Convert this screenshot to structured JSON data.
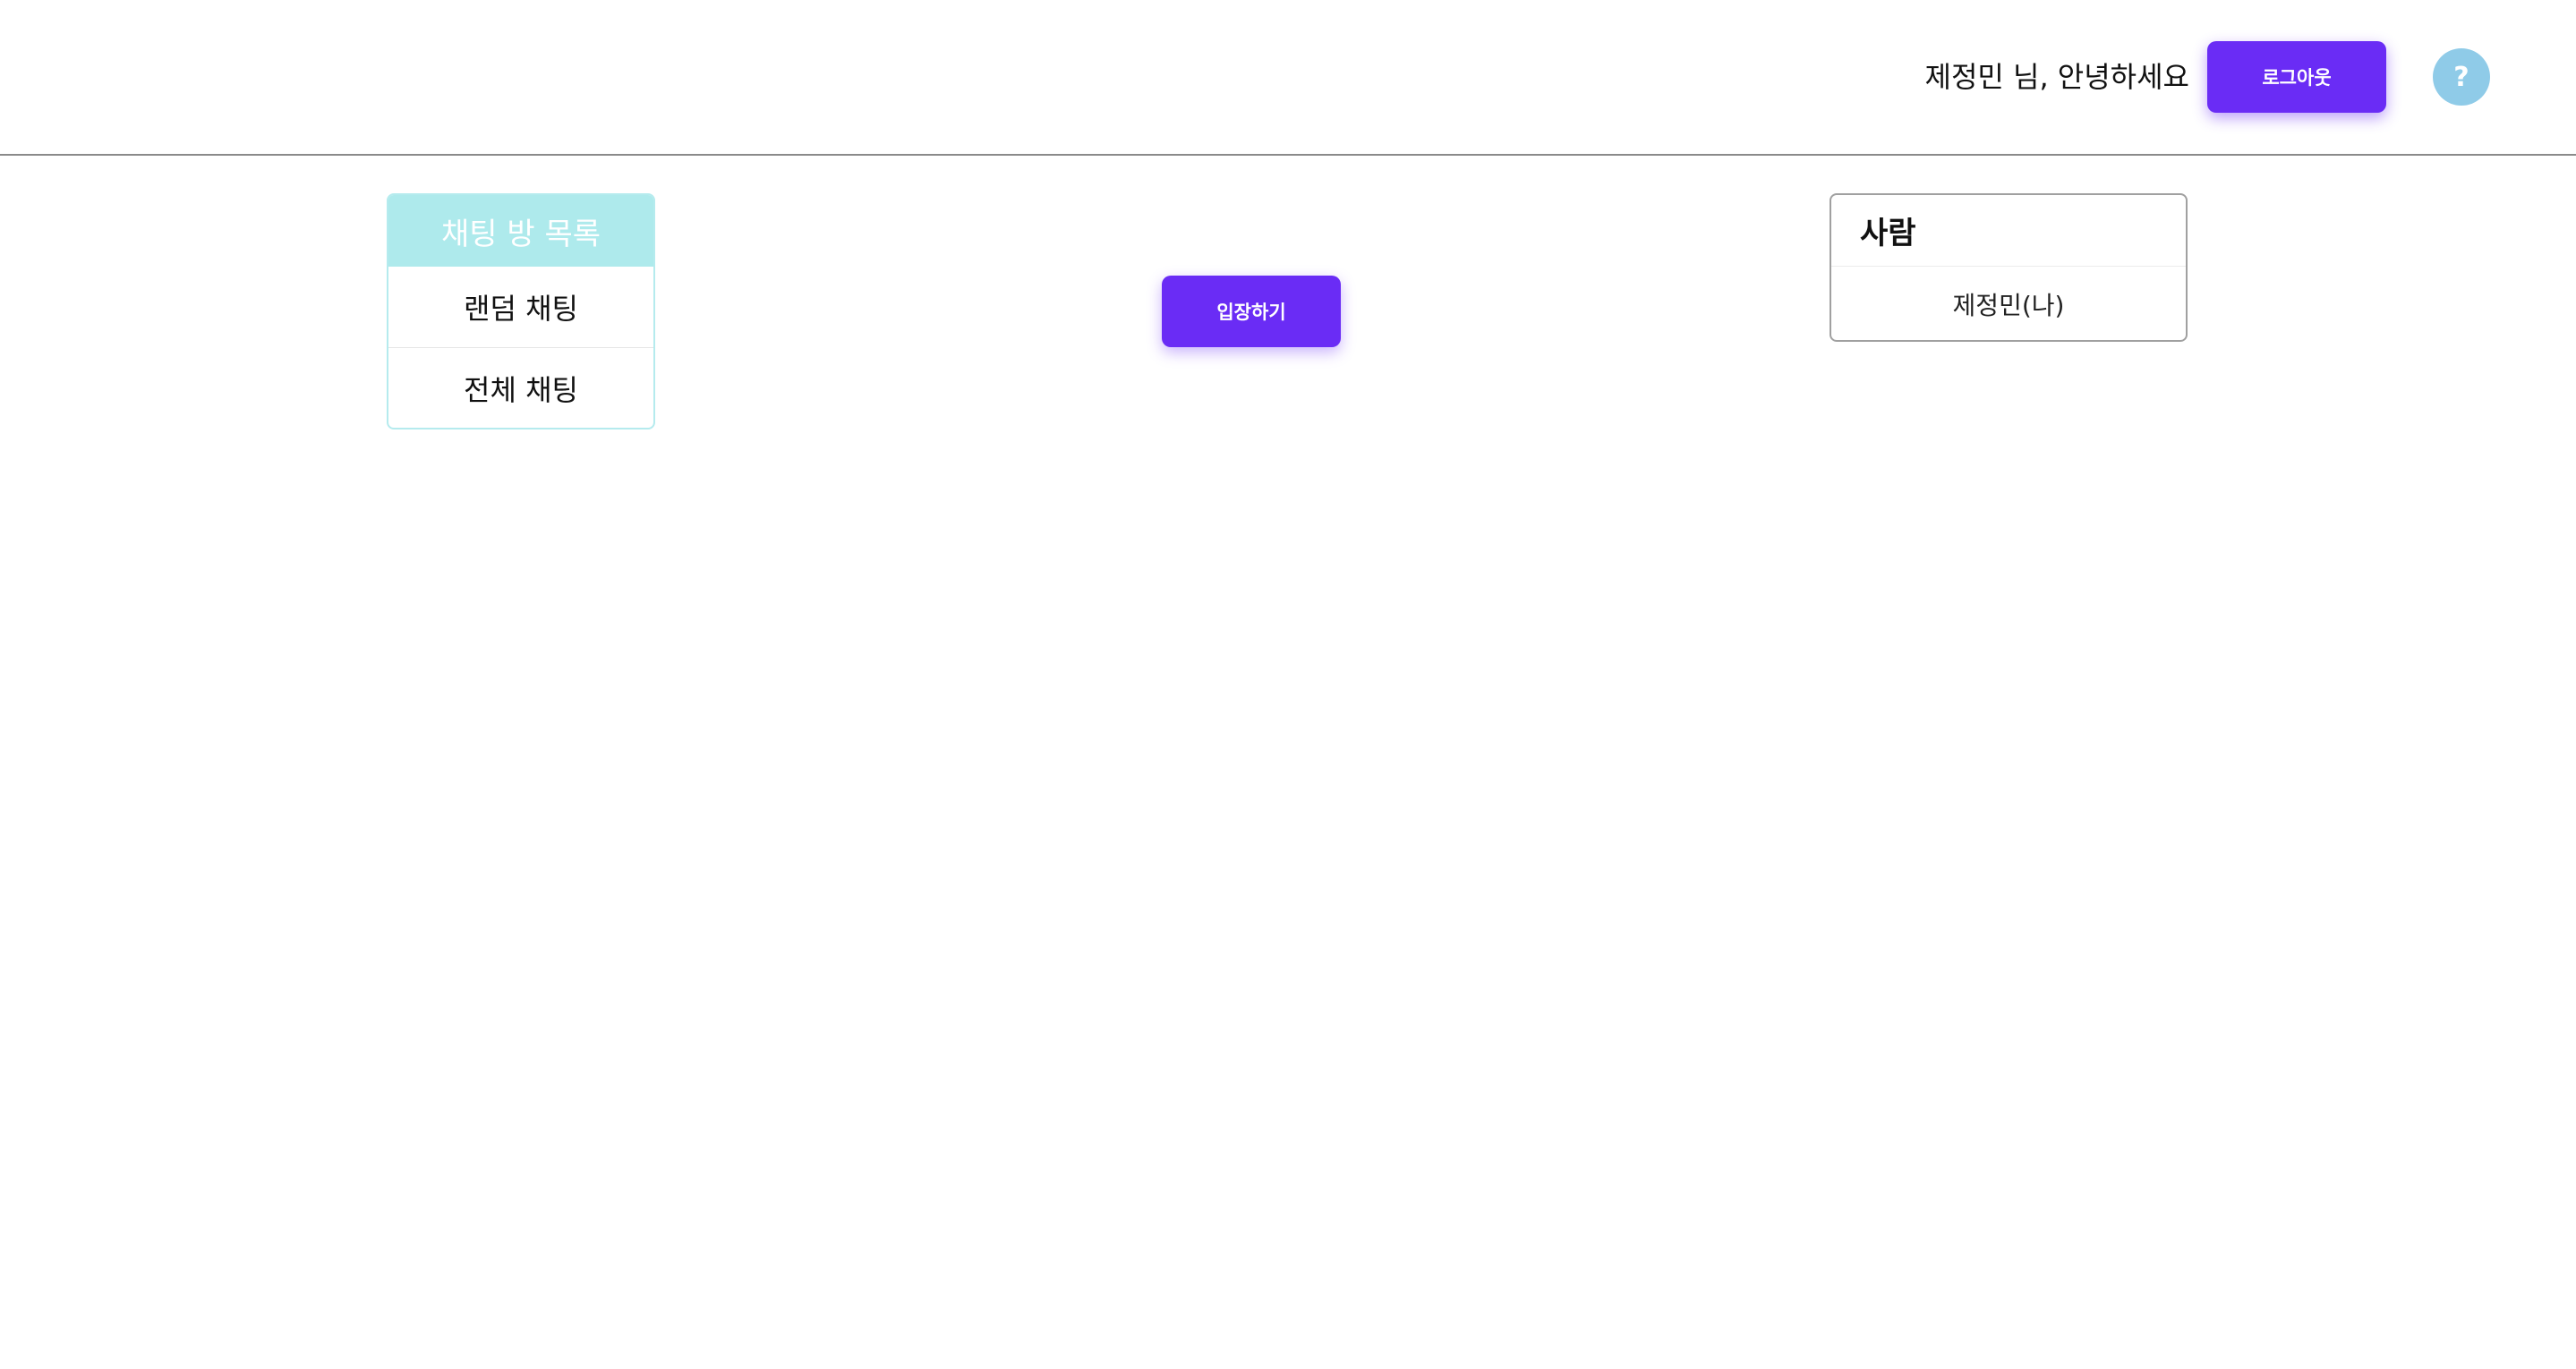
{
  "header": {
    "greeting": "제정민 님, 안녕하세요",
    "logout_label": "로그아웃",
    "help_label": "?"
  },
  "room_list": {
    "title": "채팅 방 목록",
    "items": [
      {
        "label": "랜덤 채팅"
      },
      {
        "label": "전체 채팅"
      }
    ]
  },
  "main": {
    "enter_label": "입장하기"
  },
  "people": {
    "title": "사람",
    "items": [
      {
        "label": "제정민(나)"
      }
    ]
  },
  "colors": {
    "accent": "#6a2cf5",
    "room_header_bg": "#aeeaec",
    "help_bg": "#8fcbe8"
  }
}
